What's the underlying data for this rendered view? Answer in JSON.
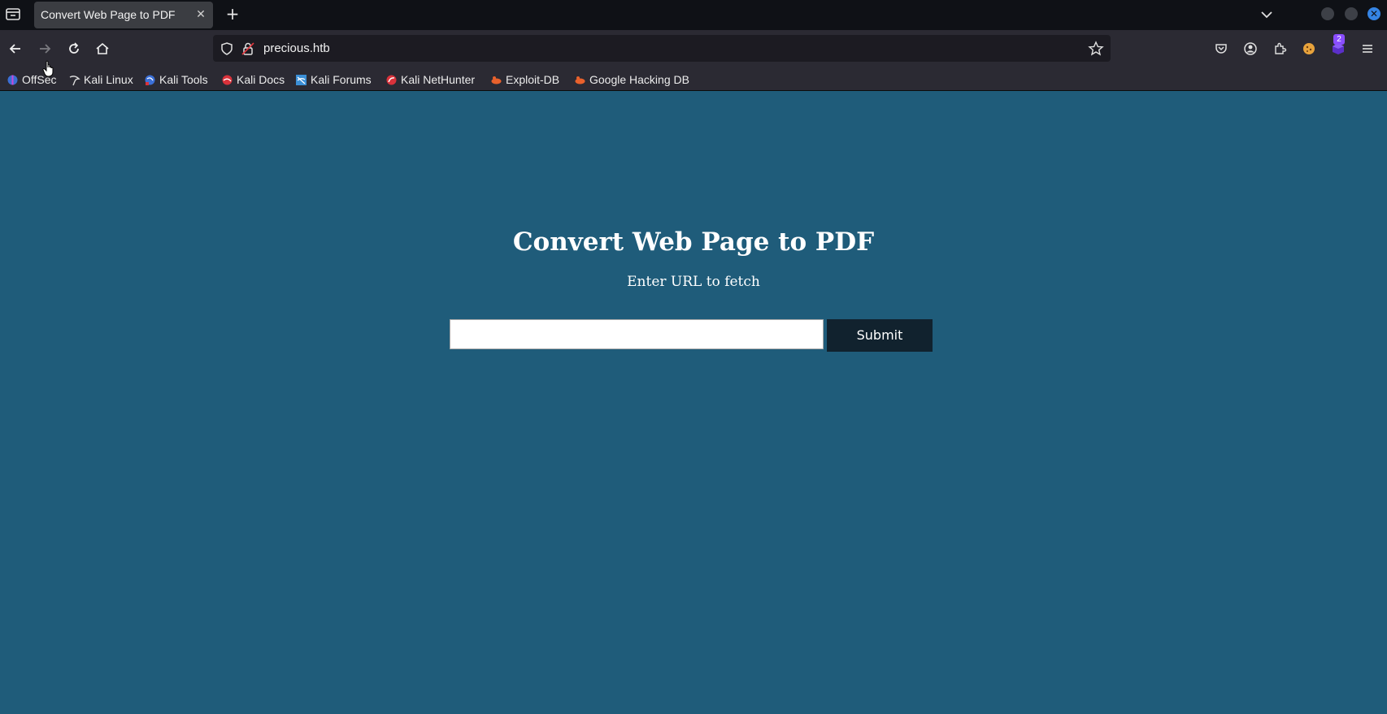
{
  "browser": {
    "tab": {
      "title": "Convert Web Page to PDF",
      "close_glyph": "✕"
    },
    "new_tab_glyph": "+",
    "url": "precious.htb",
    "extensions_badge": "2",
    "window_close_glyph": "✕"
  },
  "bookmarks": [
    {
      "label": "OffSec",
      "icon": "offsec-icon",
      "color": "#3b6fd6"
    },
    {
      "label": "Kali Linux",
      "icon": "kali-dragon-icon",
      "color": "#cfcfcf"
    },
    {
      "label": "Kali Tools",
      "icon": "kali-tools-icon",
      "color": "#3b6fd6"
    },
    {
      "label": "Kali Docs",
      "icon": "kali-docs-icon",
      "color": "#d9323b"
    },
    {
      "label": "Kali Forums",
      "icon": "kali-forums-icon",
      "color": "#3b8fd6"
    },
    {
      "label": "Kali NetHunter",
      "icon": "nethunter-icon",
      "color": "#d9323b"
    },
    {
      "label": "Exploit-DB",
      "icon": "exploit-db-icon",
      "color": "#e8612c"
    },
    {
      "label": "Google Hacking DB",
      "icon": "ghdb-icon",
      "color": "#e8612c"
    }
  ],
  "page": {
    "title": "Convert Web Page to PDF",
    "subtitle": "Enter URL to fetch",
    "input_value": "",
    "submit_label": "Submit"
  },
  "colors": {
    "page_background": "#1f5c7a",
    "submit_background": "#11222e"
  }
}
